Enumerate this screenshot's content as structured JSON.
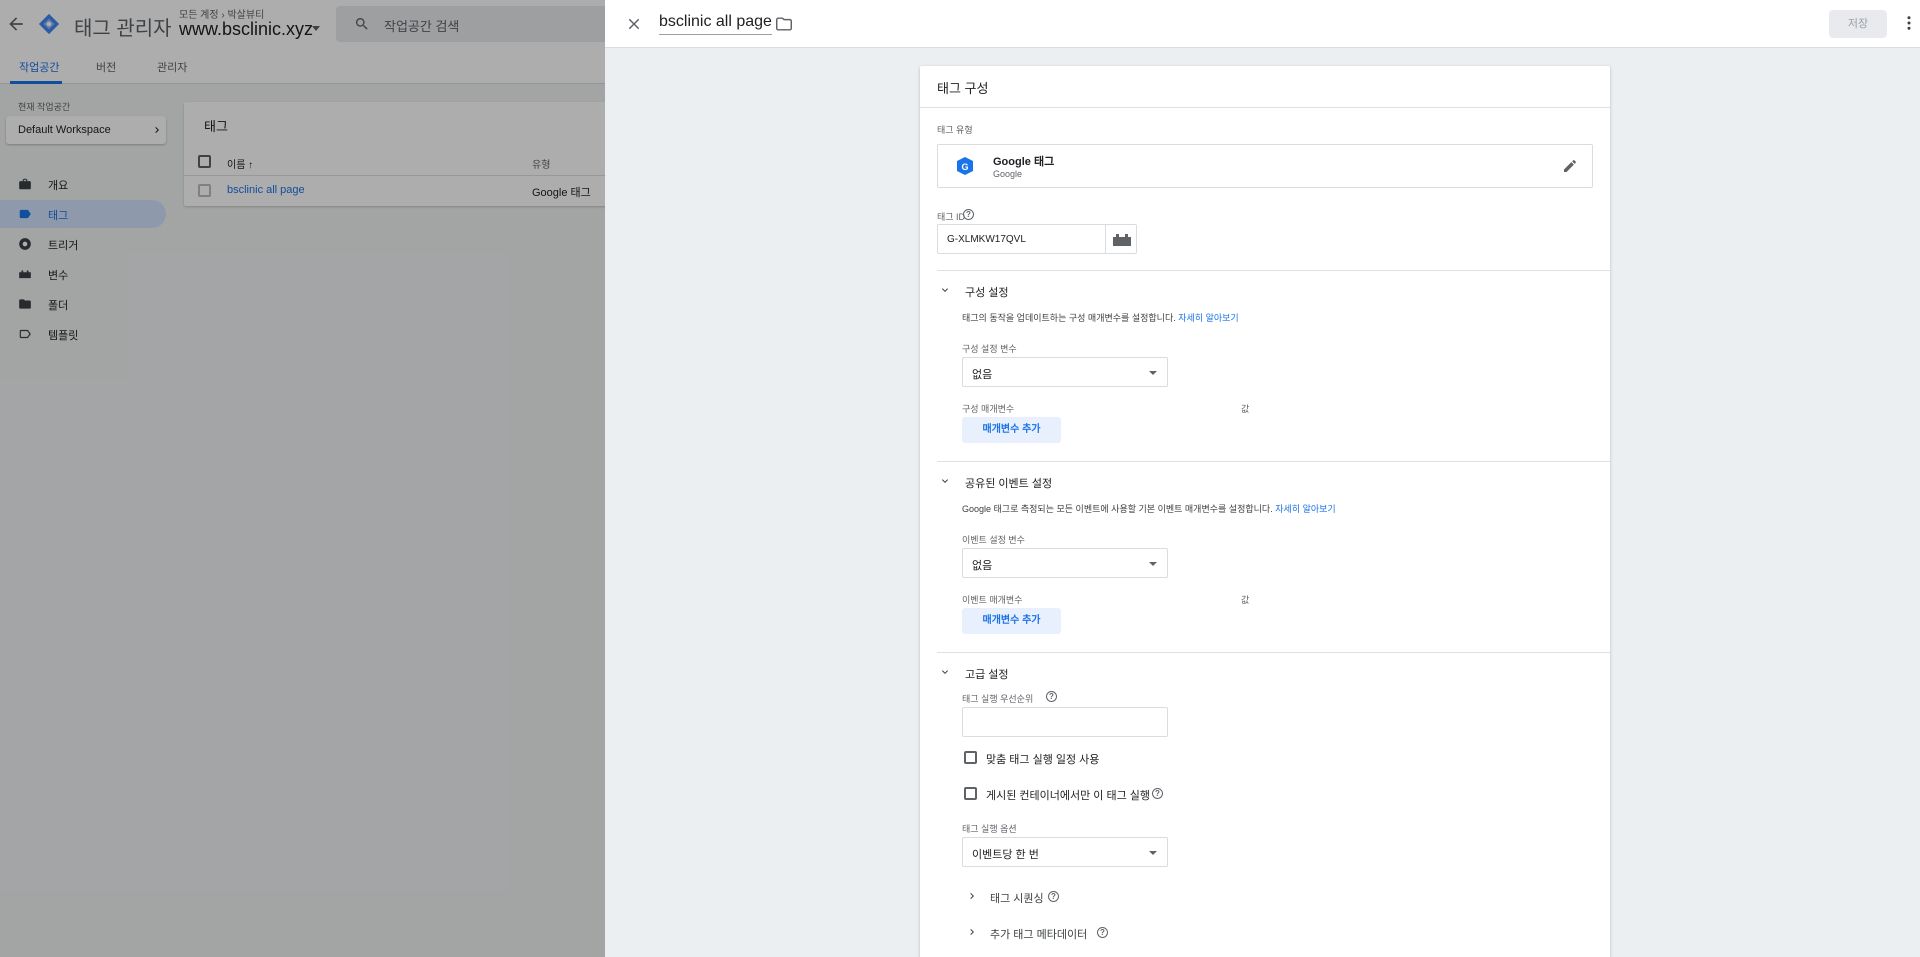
{
  "colors": {
    "accent": "#1a73e8",
    "active_nav_bg": "#d2e3fc",
    "overlay": "rgba(0,0,0,0.32)",
    "add_button_bg": "#e8f0fe"
  },
  "app": {
    "product_name": "태그 관리자",
    "breadcrumb": [
      "모든 계정",
      "박살뷰티"
    ],
    "container_name": "www.bsclinic.xyz",
    "search_placeholder": "작업공간 검색",
    "tabs": [
      {
        "label": "작업공간",
        "active": true
      },
      {
        "label": "버전",
        "active": false
      },
      {
        "label": "관리자",
        "active": false
      }
    ],
    "workspace_label": "현재 작업공간",
    "workspace_name": "Default Workspace",
    "sidebar": [
      {
        "label": "개요",
        "icon": "briefcase-icon",
        "active": false
      },
      {
        "label": "태그",
        "icon": "tag-icon",
        "active": true
      },
      {
        "label": "트리거",
        "icon": "trigger-icon",
        "active": false
      },
      {
        "label": "변수",
        "icon": "variables-icon",
        "active": false
      },
      {
        "label": "폴더",
        "icon": "folder-icon",
        "active": false
      },
      {
        "label": "템플릿",
        "icon": "template-icon",
        "active": false
      }
    ],
    "tags_card": {
      "title": "태그",
      "col_name": "이름 ↑",
      "col_type": "유형",
      "rows": [
        {
          "name": "bsclinic all page",
          "type": "Google 태그"
        }
      ]
    }
  },
  "panel": {
    "title": "bsclinic all page",
    "save_label": "저장",
    "card_title": "태그 구성",
    "tag_type_label": "태그 유형",
    "tag_type_name": "Google 태그",
    "tag_type_vendor": "Google",
    "tag_id_label": "태그 ID",
    "tag_id_value": "G-XLMKW17QVL",
    "config_section": {
      "title": "구성 설정",
      "desc": "태그의 동작을 업데이트하는 구성 매개변수를 설정합니다.",
      "learn_more": "자세히 알아보기",
      "var_label": "구성 설정 변수",
      "var_value": "없음",
      "param_label": "구성 매개변수",
      "value_label": "값",
      "add_button": "매개변수 추가"
    },
    "event_section": {
      "title": "공유된 이벤트 설정",
      "desc": "Google 태그로 측정되는 모든 이벤트에 사용할 기본 이벤트 매개변수를 설정합니다.",
      "learn_more": "자세히 알아보기",
      "var_label": "이벤트 설정 변수",
      "var_value": "없음",
      "param_label": "이벤트 매개변수",
      "value_label": "값",
      "add_button": "매개변수 추가"
    },
    "advanced_section": {
      "title": "고급 설정",
      "priority_label": "태그 실행 우선순위",
      "priority_value": "",
      "custom_schedule_label": "맞춤 태그 실행 일정 사용",
      "custom_schedule_checked": false,
      "published_only_label": "게시된 컨테이너에서만 이 태그 실행",
      "published_only_checked": false,
      "firing_option_label": "태그 실행 옵션",
      "firing_option_value": "이벤트당 한 번",
      "tag_sequencing": "태그 시퀀싱",
      "extra_metadata": "추가 태그 메타데이터"
    }
  }
}
